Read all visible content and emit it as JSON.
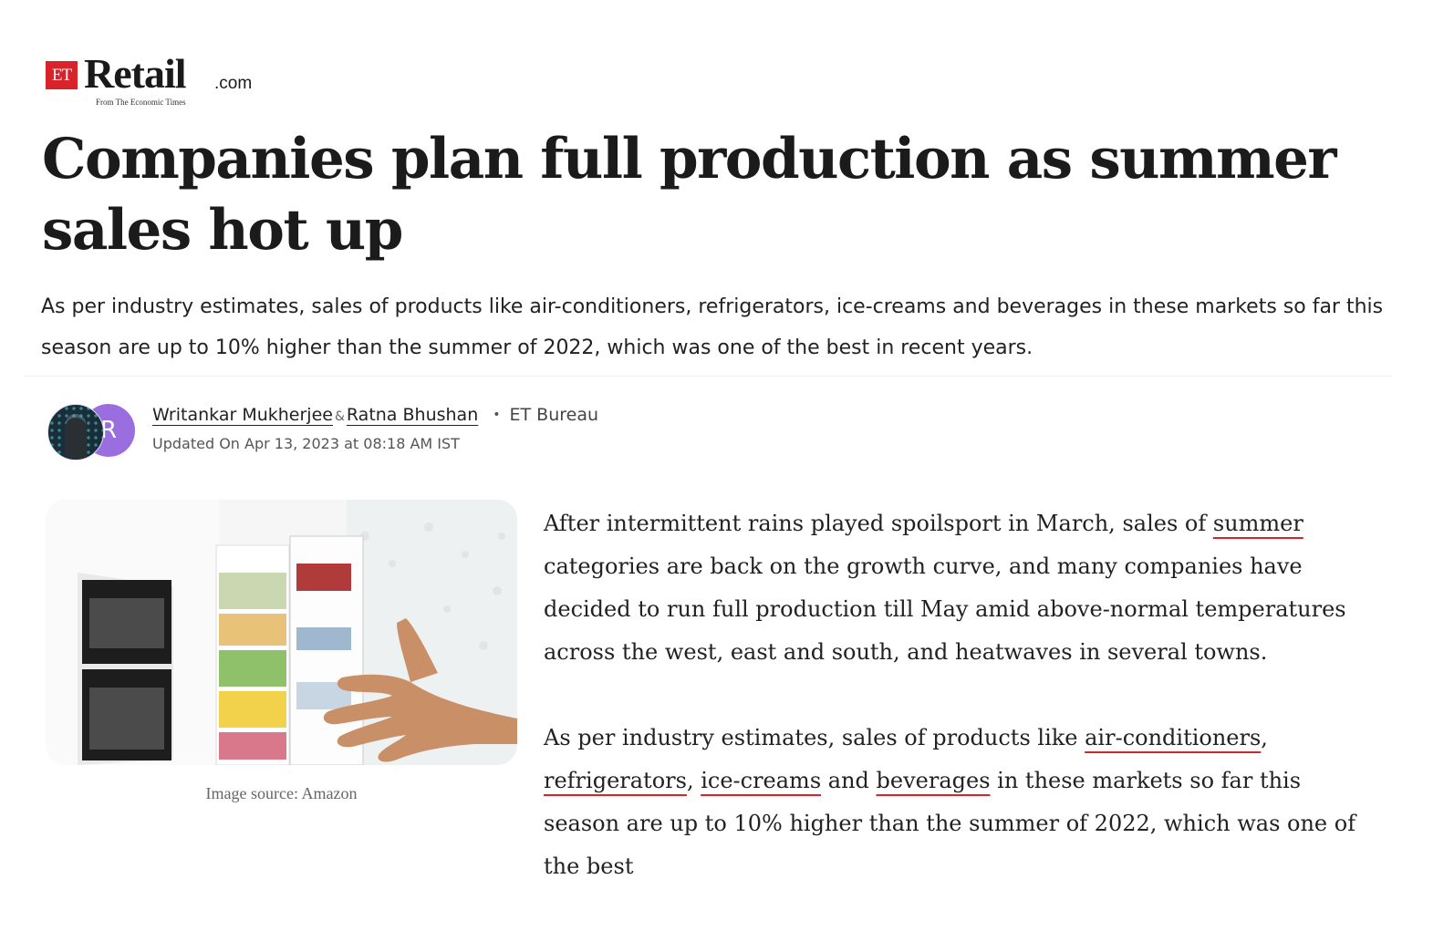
{
  "brand": {
    "et": "ET",
    "name": "Retail",
    "domain": ".com",
    "tagline": "From The Economic Times",
    "accent": "#d8232a"
  },
  "article": {
    "title": "Companies plan full production as summer sales hot up",
    "summary": "As per industry estimates, sales of products like air-conditioners, refrigerators, ice-creams and beverages in these markets so far this season are up to 10% higher than the summer of 2022, which was one of the best in recent years.",
    "authors": [
      {
        "name": "Writankar Mukherjee",
        "avatar": "photo"
      },
      {
        "name": "Ratna Bhushan",
        "avatar_initial": "R",
        "avatar_color": "#9b6ee0"
      }
    ],
    "author_sep": "&",
    "bureau_dot": "•",
    "bureau": "ET Bureau",
    "updated": "Updated On Apr 13, 2023 at 08:18 AM IST",
    "image_caption": "Image source: Amazon",
    "p1": {
      "before": "After intermittent rains played spoilsport in March, sales of ",
      "link": "summer",
      "after": " categories are back on the growth curve, and many companies have decided to run full production till May amid above-normal temperatures across the west, east and south, and heatwaves in several towns."
    },
    "p2": {
      "t1": "As per industry estimates, sales of products like ",
      "l1": "air-conditioners",
      "t2": ", ",
      "l2": "refrigerators",
      "t3": ", ",
      "l3": "ice-creams",
      "t4": " and ",
      "l4": "beverages",
      "t5": " in these markets so far this season are up to 10% higher than the summer of 2022, which was one of the best"
    }
  }
}
